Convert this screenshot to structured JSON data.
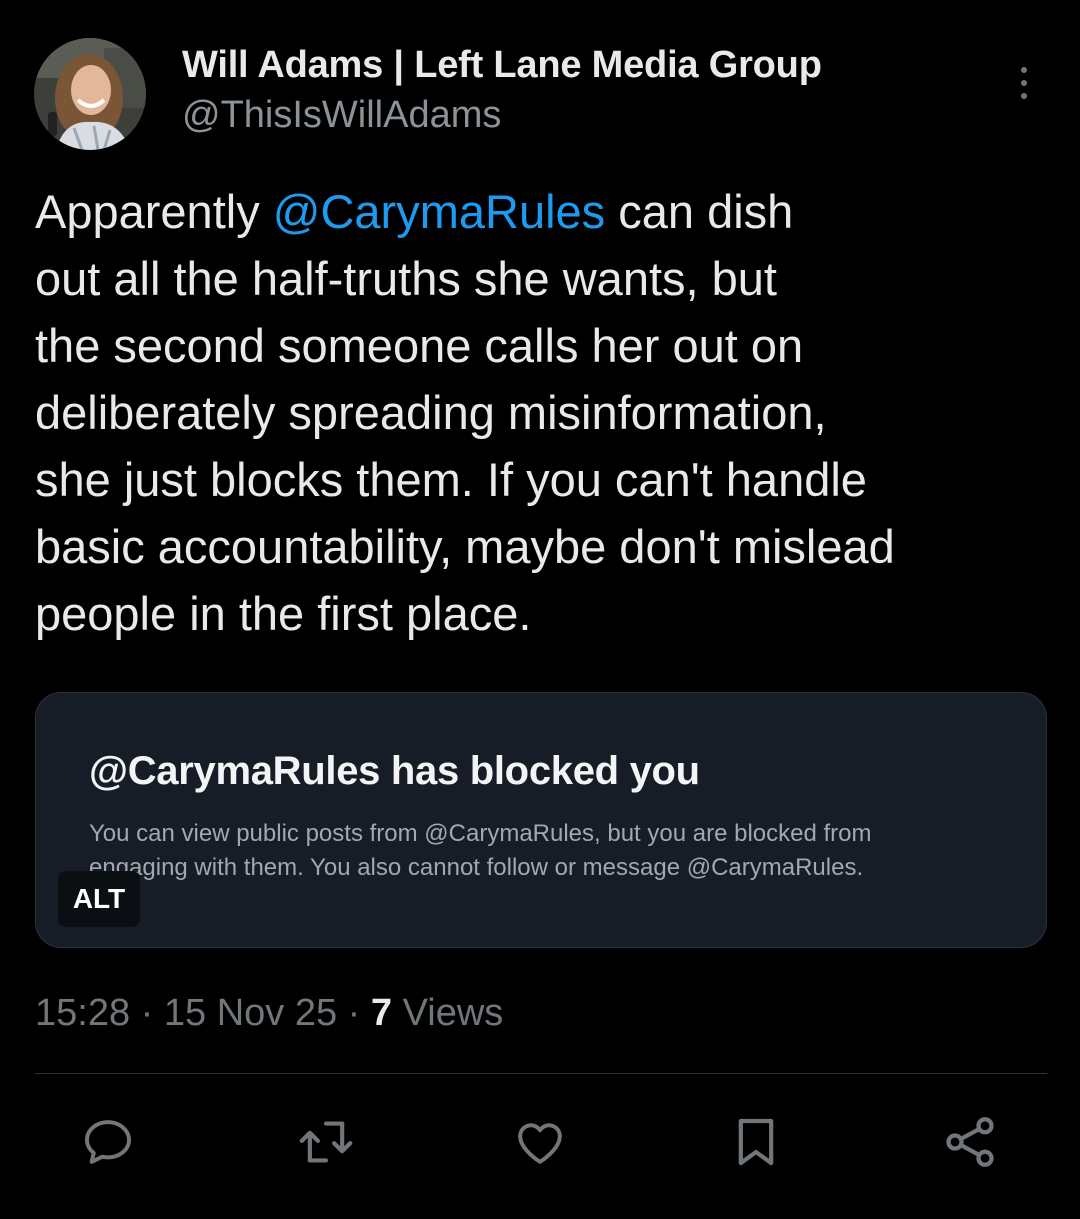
{
  "author": {
    "display_name": "Will Adams | Left Lane Media Group",
    "handle": "@ThisIsWillAdams"
  },
  "tweet": {
    "lines": [
      {
        "pre": "Apparently ",
        "mention": "@CarymaRules",
        "post": " can dish"
      },
      {
        "text": "out all the half-truths she wants, but"
      },
      {
        "text": "the second someone calls her out on"
      },
      {
        "text": "deliberately spreading misinformation,"
      },
      {
        "text": "she just blocks them. If you can't handle"
      },
      {
        "text": "basic accountability, maybe don't mislead"
      },
      {
        "text": "people in the first place."
      }
    ]
  },
  "media": {
    "title": "@CarymaRules has blocked you",
    "body_line1": "You can view public posts from @CarymaRules, but you are blocked from",
    "body_line2": "engaging with them. You also cannot follow or message @CarymaRules.",
    "alt_label": "ALT"
  },
  "meta": {
    "time": "15:28",
    "separator": " · ",
    "date": "15 Nov 25",
    "views_count": "7",
    "views_label": "Views"
  },
  "actions": [
    {
      "name": "reply",
      "icon": "reply-icon"
    },
    {
      "name": "repost",
      "icon": "repost-icon"
    },
    {
      "name": "like",
      "icon": "heart-icon"
    },
    {
      "name": "bookmark",
      "icon": "bookmark-icon"
    },
    {
      "name": "share",
      "icon": "share-icon"
    }
  ],
  "colors": {
    "background": "#000000",
    "text": "#e7e9ea",
    "secondary_text": "#71767b",
    "mention": "#1d9bf0",
    "card_background": "#171d26"
  }
}
